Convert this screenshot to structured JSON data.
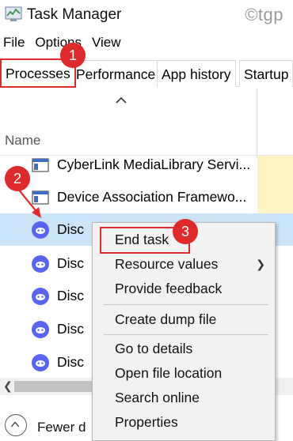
{
  "window": {
    "title": "Task Manager",
    "watermark": "©tgp"
  },
  "menu": {
    "items": [
      "File",
      "Options",
      "View"
    ]
  },
  "tabs": [
    "Processes",
    "Performance",
    "App history",
    "Startup"
  ],
  "columns": {
    "name": "Name"
  },
  "rows": [
    {
      "label": "CyberLink MediaLibrary Servi...",
      "icon": "app-window-icon"
    },
    {
      "label": "Device Association Framewo...",
      "icon": "app-window-icon"
    },
    {
      "label": "Disc",
      "icon": "discord-icon",
      "selected": true
    },
    {
      "label": "Disc",
      "icon": "discord-icon"
    },
    {
      "label": "Disc",
      "icon": "discord-icon"
    },
    {
      "label": "Disc",
      "icon": "discord-icon"
    },
    {
      "label": "Disc",
      "icon": "discord-icon"
    }
  ],
  "context_menu": {
    "end_task": "End task",
    "resource_values": "Resource values",
    "provide_feedback": "Provide feedback",
    "create_dump_file": "Create dump file",
    "go_to_details": "Go to details",
    "open_file_location": "Open file location",
    "search_online": "Search online",
    "properties": "Properties"
  },
  "footer": {
    "fewer_details": "Fewer d"
  },
  "annotations": [
    "1",
    "2",
    "3"
  ],
  "colors": {
    "accent_red": "#e02a2a",
    "selection": "#cce4f7",
    "discord": "#5865f2",
    "cpu_column": "#fff4c4"
  }
}
